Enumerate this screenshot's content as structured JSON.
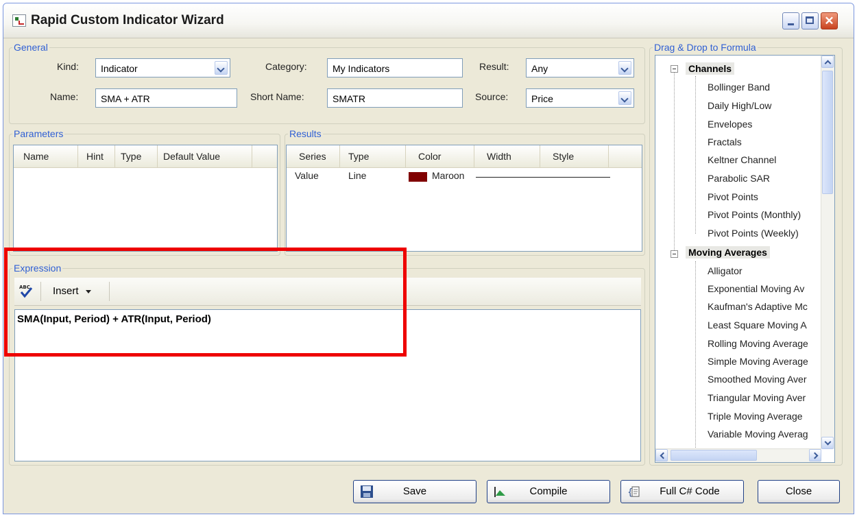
{
  "window": {
    "title": "Rapid Custom Indicator Wizard"
  },
  "general": {
    "legend": "General",
    "kind_label": "Kind:",
    "kind_value": "Indicator",
    "category_label": "Category:",
    "category_value": "My Indicators",
    "result_label": "Result:",
    "result_value": "Any",
    "name_label": "Name:",
    "name_value": "SMA + ATR",
    "short_name_label": "Short Name:",
    "short_name_value": "SMATR",
    "source_label": "Source:",
    "source_value": "Price"
  },
  "parameters": {
    "legend": "Parameters",
    "columns": [
      "Name",
      "Hint",
      "Type",
      "Default Value"
    ]
  },
  "results": {
    "legend": "Results",
    "columns": [
      "Series",
      "Type",
      "Color",
      "Width",
      "Style"
    ],
    "rows": [
      {
        "series": "Value",
        "type": "Line",
        "color_name": "Maroon",
        "color_hex": "#800000"
      }
    ]
  },
  "expression": {
    "legend": "Expression",
    "insert_label": "Insert",
    "text": "SMA(Input, Period) + ATR(Input, Period)"
  },
  "formula_tree": {
    "legend": "Drag & Drop to Formula",
    "groups": [
      {
        "name": "Channels",
        "items": [
          "Bollinger Band",
          "Daily High/Low",
          "Envelopes",
          "Fractals",
          "Keltner Channel",
          "Parabolic SAR",
          "Pivot Points",
          "Pivot Points (Monthly)",
          "Pivot Points (Weekly)"
        ]
      },
      {
        "name": "Moving Averages",
        "items": [
          "Alligator",
          "Exponential Moving Av",
          "Kaufman's Adaptive Mc",
          "Least Square Moving A",
          "Rolling Moving Average",
          "Simple Moving Average",
          "Smoothed Moving Aver",
          "Triangular Moving Aver",
          "Triple Moving Average",
          "Variable Moving Averag"
        ]
      }
    ]
  },
  "buttons": {
    "save": "Save",
    "compile": "Compile",
    "full_code": "Full C# Code",
    "close": "Close"
  },
  "colors": {
    "legend": "#2f5fd4",
    "highlight": "#ee0000",
    "maroon": "#800000"
  }
}
